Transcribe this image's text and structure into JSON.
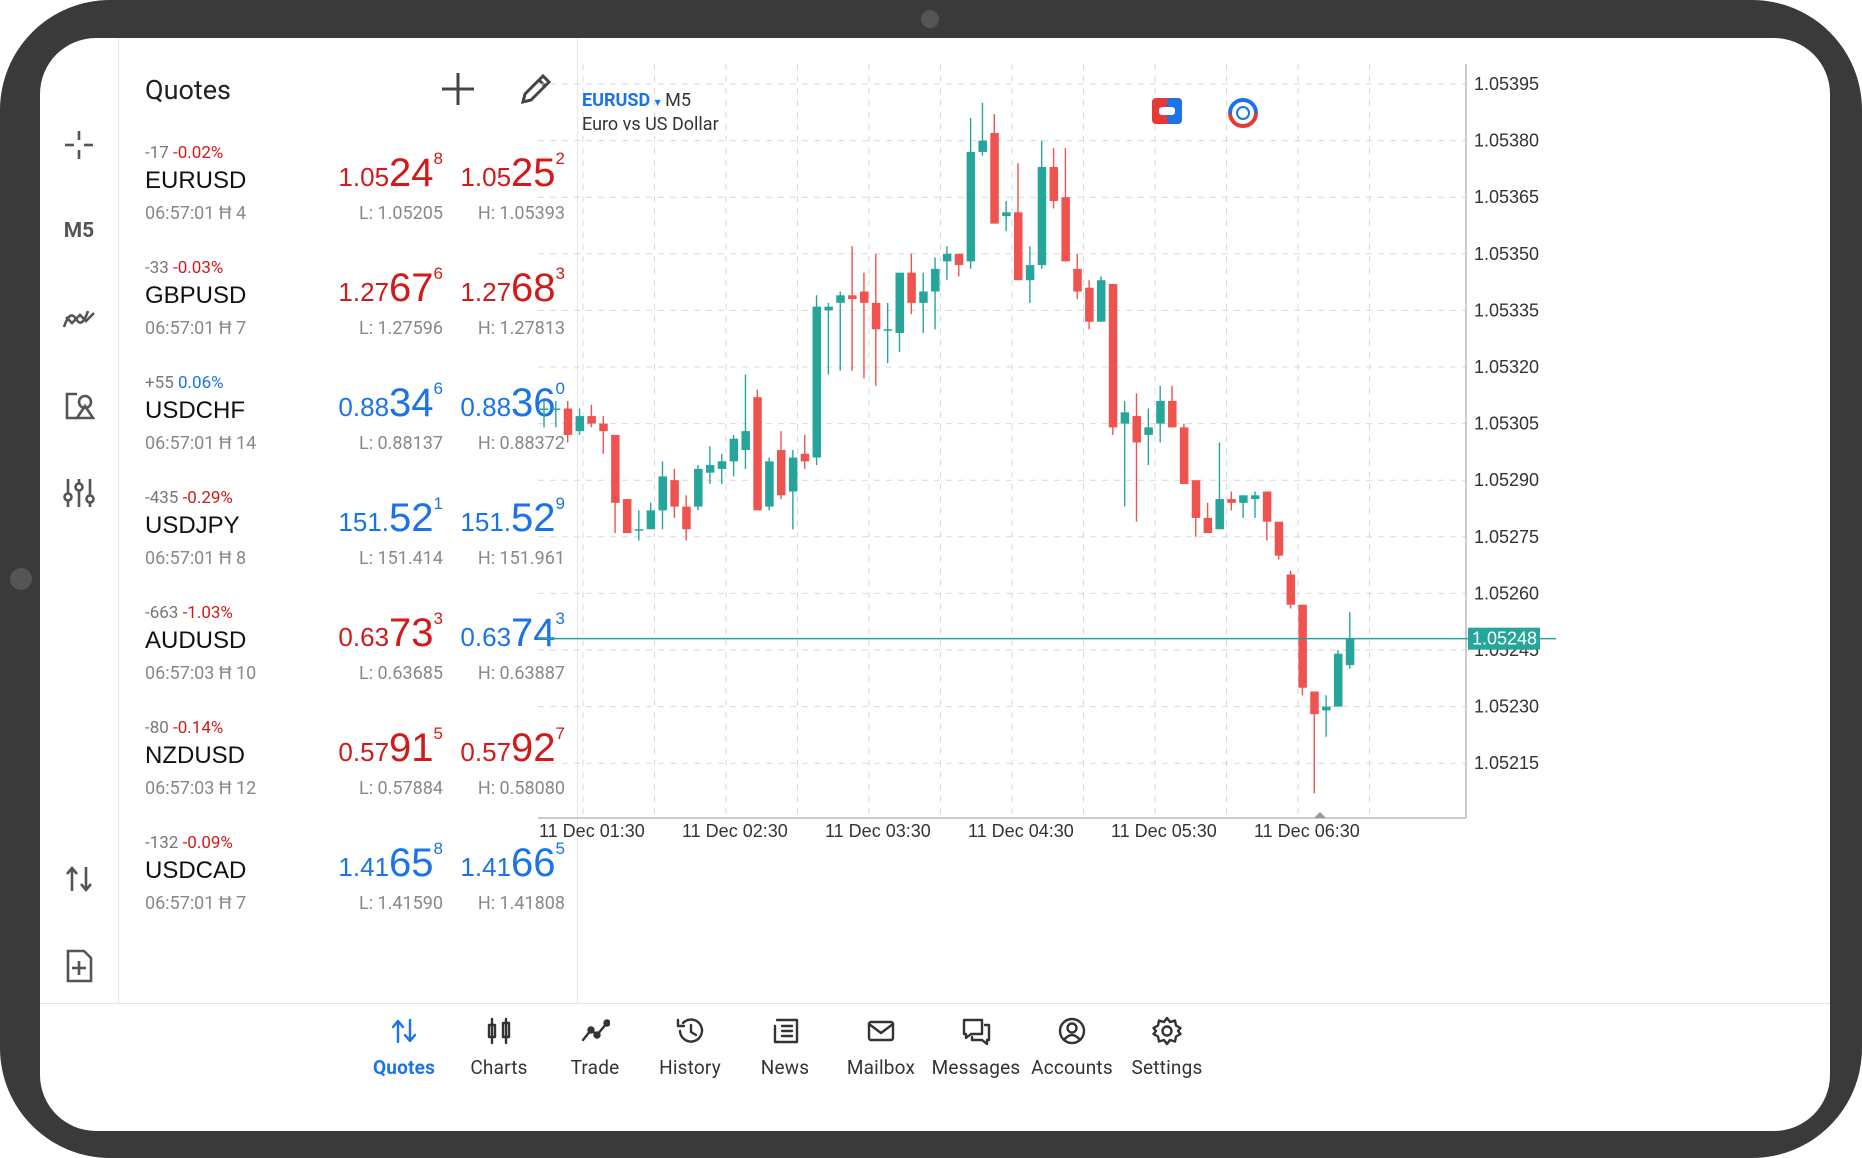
{
  "toolbar": {
    "timeframe": "M5",
    "items": [
      "crosshair-icon",
      "timeframe",
      "indicators-icon",
      "objects-icon",
      "settings-sliders-icon",
      "trade-arrows-icon",
      "new-order-icon"
    ]
  },
  "quotes": {
    "title": "Quotes",
    "rows": [
      {
        "points": "-17",
        "pct": "-0.02%",
        "dir": "down",
        "symbol": "EURUSD",
        "time": "06:57:01",
        "spread": "4",
        "bid": {
          "small": "1.05",
          "big": "24",
          "sup": "8",
          "color": "red"
        },
        "ask": {
          "small": "1.05",
          "big": "25",
          "sup": "2",
          "color": "red"
        },
        "low": "L: 1.05205",
        "high": "H: 1.05393"
      },
      {
        "points": "-33",
        "pct": "-0.03%",
        "dir": "down",
        "symbol": "GBPUSD",
        "time": "06:57:01",
        "spread": "7",
        "bid": {
          "small": "1.27",
          "big": "67",
          "sup": "6",
          "color": "red"
        },
        "ask": {
          "small": "1.27",
          "big": "68",
          "sup": "3",
          "color": "red"
        },
        "low": "L: 1.27596",
        "high": "H: 1.27813"
      },
      {
        "points": "+55",
        "pct": "0.06%",
        "dir": "up",
        "symbol": "USDCHF",
        "time": "06:57:01",
        "spread": "14",
        "bid": {
          "small": "0.88",
          "big": "34",
          "sup": "6",
          "color": "blue"
        },
        "ask": {
          "small": "0.88",
          "big": "36",
          "sup": "0",
          "color": "blue"
        },
        "low": "L: 0.88137",
        "high": "H: 0.88372"
      },
      {
        "points": "-435",
        "pct": "-0.29%",
        "dir": "down",
        "symbol": "USDJPY",
        "time": "06:57:01",
        "spread": "8",
        "bid": {
          "small": "151.",
          "big": "52",
          "sup": "1",
          "color": "blue"
        },
        "ask": {
          "small": "151.",
          "big": "52",
          "sup": "9",
          "color": "blue"
        },
        "low": "L: 151.414",
        "high": "H: 151.961"
      },
      {
        "points": "-663",
        "pct": "-1.03%",
        "dir": "down",
        "symbol": "AUDUSD",
        "time": "06:57:03",
        "spread": "10",
        "bid": {
          "small": "0.63",
          "big": "73",
          "sup": "3",
          "color": "red"
        },
        "ask": {
          "small": "0.63",
          "big": "74",
          "sup": "3",
          "color": "blue"
        },
        "low": "L: 0.63685",
        "high": "H: 0.63887"
      },
      {
        "points": "-80",
        "pct": "-0.14%",
        "dir": "down",
        "symbol": "NZDUSD",
        "time": "06:57:03",
        "spread": "12",
        "bid": {
          "small": "0.57",
          "big": "91",
          "sup": "5",
          "color": "red"
        },
        "ask": {
          "small": "0.57",
          "big": "92",
          "sup": "7",
          "color": "red"
        },
        "low": "L: 0.57884",
        "high": "H: 0.58080"
      },
      {
        "points": "-132",
        "pct": "-0.09%",
        "dir": "down",
        "symbol": "USDCAD",
        "time": "06:57:01",
        "spread": "7",
        "bid": {
          "small": "1.41",
          "big": "65",
          "sup": "8",
          "color": "blue"
        },
        "ask": {
          "small": "1.41",
          "big": "66",
          "sup": "5",
          "color": "blue"
        },
        "low": "L: 1.41590",
        "high": "H: 1.41808"
      }
    ]
  },
  "chart": {
    "symbol": "EURUSD",
    "timeframe": "M5",
    "description": "Euro vs US Dollar",
    "current_price": "1.05248",
    "colors": {
      "up": "#26a69a",
      "down": "#ef5350",
      "grid": "#d9d9d9",
      "price_line": "#26a69a"
    }
  },
  "chart_data": {
    "type": "candlestick",
    "title": "EURUSD M5",
    "ylim": [
      1.05205,
      1.05398
    ],
    "y_ticks": [
      "1.05395",
      "1.05380",
      "1.05365",
      "1.05350",
      "1.05335",
      "1.05320",
      "1.05305",
      "1.05290",
      "1.05275",
      "1.05260",
      "1.05245",
      "1.05230",
      "1.05215"
    ],
    "x_ticks": [
      "11 Dec 01:30",
      "11 Dec 02:30",
      "11 Dec 03:30",
      "11 Dec 04:30",
      "11 Dec 05:30",
      "11 Dec 06:30"
    ],
    "current_price": 1.05248,
    "candles": [
      {
        "o": 1.05309,
        "h": 1.05311,
        "l": 1.05304,
        "c": 1.05309
      },
      {
        "o": 1.05309,
        "h": 1.05311,
        "l": 1.05304,
        "c": 1.05309
      },
      {
        "o": 1.05309,
        "h": 1.05311,
        "l": 1.053,
        "c": 1.05302
      },
      {
        "o": 1.05303,
        "h": 1.05309,
        "l": 1.05302,
        "c": 1.05307
      },
      {
        "o": 1.05307,
        "h": 1.0531,
        "l": 1.05304,
        "c": 1.05305
      },
      {
        "o": 1.05305,
        "h": 1.05307,
        "l": 1.05297,
        "c": 1.05303
      },
      {
        "o": 1.05302,
        "h": 1.05302,
        "l": 1.05276,
        "c": 1.05284
      },
      {
        "o": 1.05285,
        "h": 1.05285,
        "l": 1.05276,
        "c": 1.05276
      },
      {
        "o": 1.05277,
        "h": 1.05282,
        "l": 1.05274,
        "c": 1.05277
      },
      {
        "o": 1.05277,
        "h": 1.05284,
        "l": 1.05277,
        "c": 1.05282
      },
      {
        "o": 1.05282,
        "h": 1.05295,
        "l": 1.05277,
        "c": 1.05291
      },
      {
        "o": 1.0529,
        "h": 1.05293,
        "l": 1.0528,
        "c": 1.05283
      },
      {
        "o": 1.05283,
        "h": 1.05286,
        "l": 1.05274,
        "c": 1.05277
      },
      {
        "o": 1.05283,
        "h": 1.05294,
        "l": 1.05282,
        "c": 1.05293
      },
      {
        "o": 1.05292,
        "h": 1.05299,
        "l": 1.05289,
        "c": 1.05294
      },
      {
        "o": 1.05293,
        "h": 1.05297,
        "l": 1.05289,
        "c": 1.05295
      },
      {
        "o": 1.05295,
        "h": 1.05302,
        "l": 1.05291,
        "c": 1.05301
      },
      {
        "o": 1.05298,
        "h": 1.05318,
        "l": 1.05293,
        "c": 1.05303
      },
      {
        "o": 1.05312,
        "h": 1.05314,
        "l": 1.05282,
        "c": 1.05282
      },
      {
        "o": 1.05283,
        "h": 1.05296,
        "l": 1.05282,
        "c": 1.05295
      },
      {
        "o": 1.05298,
        "h": 1.05303,
        "l": 1.05285,
        "c": 1.05286
      },
      {
        "o": 1.05287,
        "h": 1.05298,
        "l": 1.05277,
        "c": 1.05296
      },
      {
        "o": 1.05297,
        "h": 1.05302,
        "l": 1.05293,
        "c": 1.05295
      },
      {
        "o": 1.05296,
        "h": 1.05339,
        "l": 1.05294,
        "c": 1.05336
      },
      {
        "o": 1.05335,
        "h": 1.05337,
        "l": 1.05318,
        "c": 1.05336
      },
      {
        "o": 1.05337,
        "h": 1.0534,
        "l": 1.05319,
        "c": 1.05339
      },
      {
        "o": 1.05339,
        "h": 1.05352,
        "l": 1.05319,
        "c": 1.05338
      },
      {
        "o": 1.0534,
        "h": 1.05345,
        "l": 1.05317,
        "c": 1.05337
      },
      {
        "o": 1.05337,
        "h": 1.0535,
        "l": 1.05315,
        "c": 1.0533
      },
      {
        "o": 1.0533,
        "h": 1.05337,
        "l": 1.05321,
        "c": 1.0533
      },
      {
        "o": 1.05329,
        "h": 1.05345,
        "l": 1.05324,
        "c": 1.05345
      },
      {
        "o": 1.05345,
        "h": 1.0535,
        "l": 1.05334,
        "c": 1.05337
      },
      {
        "o": 1.05337,
        "h": 1.05345,
        "l": 1.05329,
        "c": 1.0534
      },
      {
        "o": 1.0534,
        "h": 1.05349,
        "l": 1.0533,
        "c": 1.05346
      },
      {
        "o": 1.05348,
        "h": 1.05352,
        "l": 1.05343,
        "c": 1.0535
      },
      {
        "o": 1.0535,
        "h": 1.05346,
        "l": 1.05344,
        "c": 1.05347
      },
      {
        "o": 1.05348,
        "h": 1.05386,
        "l": 1.05346,
        "c": 1.05377
      },
      {
        "o": 1.05377,
        "h": 1.0539,
        "l": 1.05376,
        "c": 1.0538
      },
      {
        "o": 1.05382,
        "h": 1.05387,
        "l": 1.05358,
        "c": 1.05358
      },
      {
        "o": 1.0536,
        "h": 1.05364,
        "l": 1.05356,
        "c": 1.05361
      },
      {
        "o": 1.05361,
        "h": 1.05374,
        "l": 1.05345,
        "c": 1.05343
      },
      {
        "o": 1.05343,
        "h": 1.05352,
        "l": 1.05337,
        "c": 1.05347
      },
      {
        "o": 1.05347,
        "h": 1.0538,
        "l": 1.05346,
        "c": 1.05373
      },
      {
        "o": 1.05373,
        "h": 1.05378,
        "l": 1.05362,
        "c": 1.05364
      },
      {
        "o": 1.05365,
        "h": 1.05378,
        "l": 1.05348,
        "c": 1.05348
      },
      {
        "o": 1.05346,
        "h": 1.0535,
        "l": 1.05338,
        "c": 1.0534
      },
      {
        "o": 1.05341,
        "h": 1.05343,
        "l": 1.0533,
        "c": 1.05332
      },
      {
        "o": 1.05332,
        "h": 1.05344,
        "l": 1.05332,
        "c": 1.05343
      },
      {
        "o": 1.05342,
        "h": 1.05342,
        "l": 1.05302,
        "c": 1.05304
      },
      {
        "o": 1.05305,
        "h": 1.05311,
        "l": 1.05283,
        "c": 1.05308
      },
      {
        "o": 1.05307,
        "h": 1.05313,
        "l": 1.05279,
        "c": 1.053
      },
      {
        "o": 1.05302,
        "h": 1.05309,
        "l": 1.05294,
        "c": 1.05304
      },
      {
        "o": 1.05305,
        "h": 1.05315,
        "l": 1.053,
        "c": 1.05311
      },
      {
        "o": 1.05311,
        "h": 1.05315,
        "l": 1.05304,
        "c": 1.05304
      },
      {
        "o": 1.05304,
        "h": 1.05305,
        "l": 1.05289,
        "c": 1.05289
      },
      {
        "o": 1.0529,
        "h": 1.0529,
        "l": 1.05275,
        "c": 1.0528
      },
      {
        "o": 1.0528,
        "h": 1.05284,
        "l": 1.05277,
        "c": 1.05276
      },
      {
        "o": 1.05277,
        "h": 1.053,
        "l": 1.05277,
        "c": 1.05285
      },
      {
        "o": 1.05285,
        "h": 1.05287,
        "l": 1.05282,
        "c": 1.05284
      },
      {
        "o": 1.05284,
        "h": 1.05283,
        "l": 1.0528,
        "c": 1.05286
      },
      {
        "o": 1.05285,
        "h": 1.05287,
        "l": 1.0528,
        "c": 1.05286
      },
      {
        "o": 1.05287,
        "h": 1.05287,
        "l": 1.05274,
        "c": 1.05279
      },
      {
        "o": 1.05279,
        "h": 1.05279,
        "l": 1.05269,
        "c": 1.0527
      },
      {
        "o": 1.05265,
        "h": 1.05266,
        "l": 1.05256,
        "c": 1.05257
      },
      {
        "o": 1.05257,
        "h": 1.05256,
        "l": 1.05233,
        "c": 1.05235
      },
      {
        "o": 1.05234,
        "h": 1.05233,
        "l": 1.05207,
        "c": 1.05228
      },
      {
        "o": 1.05229,
        "h": 1.05233,
        "l": 1.05222,
        "c": 1.0523
      },
      {
        "o": 1.0523,
        "h": 1.05245,
        "l": 1.0523,
        "c": 1.05244
      },
      {
        "o": 1.05241,
        "h": 1.05255,
        "l": 1.0524,
        "c": 1.05248
      }
    ]
  },
  "nav": {
    "items": [
      {
        "label": "Quotes",
        "icon": "quotes-arrows-icon",
        "active": true
      },
      {
        "label": "Charts",
        "icon": "candlestick-icon",
        "active": false
      },
      {
        "label": "Trade",
        "icon": "trade-trend-icon",
        "active": false
      },
      {
        "label": "History",
        "icon": "history-clock-icon",
        "active": false
      },
      {
        "label": "News",
        "icon": "news-icon",
        "active": false
      },
      {
        "label": "Mailbox",
        "icon": "mail-icon",
        "active": false
      },
      {
        "label": "Messages",
        "icon": "messages-icon",
        "active": false
      },
      {
        "label": "Accounts",
        "icon": "account-icon",
        "active": false
      },
      {
        "label": "Settings",
        "icon": "gear-icon",
        "active": false
      }
    ]
  }
}
